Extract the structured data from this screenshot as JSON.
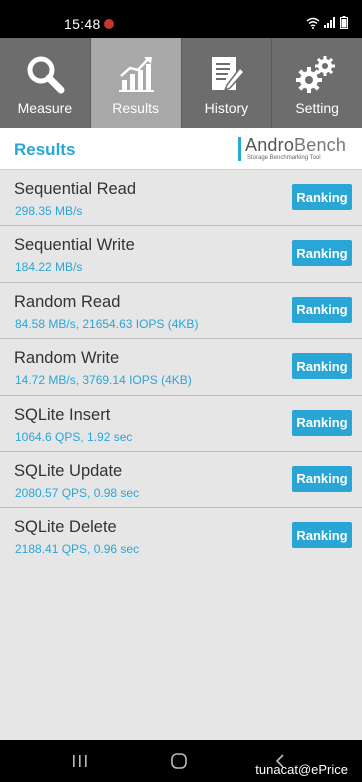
{
  "status": {
    "time": "15:48"
  },
  "tabs": [
    {
      "label": "Measure",
      "icon": "magnifier-icon",
      "active": false
    },
    {
      "label": "Results",
      "icon": "bar-chart-icon",
      "active": true
    },
    {
      "label": "History",
      "icon": "document-edit-icon",
      "active": false
    },
    {
      "label": "Setting",
      "icon": "gears-icon",
      "active": false
    }
  ],
  "header": {
    "title": "Results",
    "logo_text_a": "Andro",
    "logo_text_b": "Bench",
    "logo_sub": "Storage Benchmarking Tool"
  },
  "results": [
    {
      "title": "Sequential Read",
      "value": "298.35 MB/s",
      "button": "Ranking"
    },
    {
      "title": "Sequential Write",
      "value": "184.22 MB/s",
      "button": "Ranking"
    },
    {
      "title": "Random Read",
      "value": "84.58 MB/s, 21654.63 IOPS (4KB)",
      "button": "Ranking"
    },
    {
      "title": "Random Write",
      "value": "14.72 MB/s, 3769.14 IOPS (4KB)",
      "button": "Ranking"
    },
    {
      "title": "SQLite Insert",
      "value": "1064.6 QPS, 1.92 sec",
      "button": "Ranking"
    },
    {
      "title": "SQLite Update",
      "value": "2080.57 QPS, 0.98 sec",
      "button": "Ranking"
    },
    {
      "title": "SQLite Delete",
      "value": "2188.41 QPS, 0.96 sec",
      "button": "Ranking"
    }
  ],
  "watermark": "tunacat@ePrice",
  "colors": {
    "accent": "#2aa6d6",
    "tab_bg": "#6d6d6d",
    "tab_active": "#a8a8a8",
    "list_bg": "#e6e6e6"
  }
}
